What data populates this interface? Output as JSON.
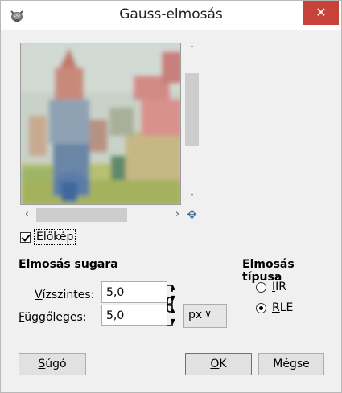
{
  "window": {
    "title": "Gauss-elmosás",
    "close_glyph": "✕",
    "app_icon": "gimp-wilber-icon"
  },
  "preview": {
    "checkbox_label": "Előkép",
    "checkbox_checked": true,
    "nav_icon": "four-arrows-move-icon"
  },
  "radius": {
    "section_title": "Elmosás sugara",
    "horizontal_label_first": "V",
    "horizontal_label_rest": "ízszintes:",
    "horizontal_value": "5,0",
    "vertical_label_first": "F",
    "vertical_label_rest": "üggőleges:",
    "vertical_value": "5,0",
    "chain_icon": "chain-link-icon",
    "unit": "px"
  },
  "blur_type": {
    "section_title": "Elmosás típusa",
    "options": [
      {
        "first": "I",
        "rest": "IR",
        "checked": false
      },
      {
        "first": "R",
        "rest": "LE",
        "checked": true
      }
    ]
  },
  "buttons": {
    "help_first": "S",
    "help_rest": "úgó",
    "ok_first": "O",
    "ok_rest": "K",
    "cancel": "Mégse"
  },
  "colors": {
    "close_red": "#c7433a",
    "accent_blue": "#3c7fb1"
  }
}
